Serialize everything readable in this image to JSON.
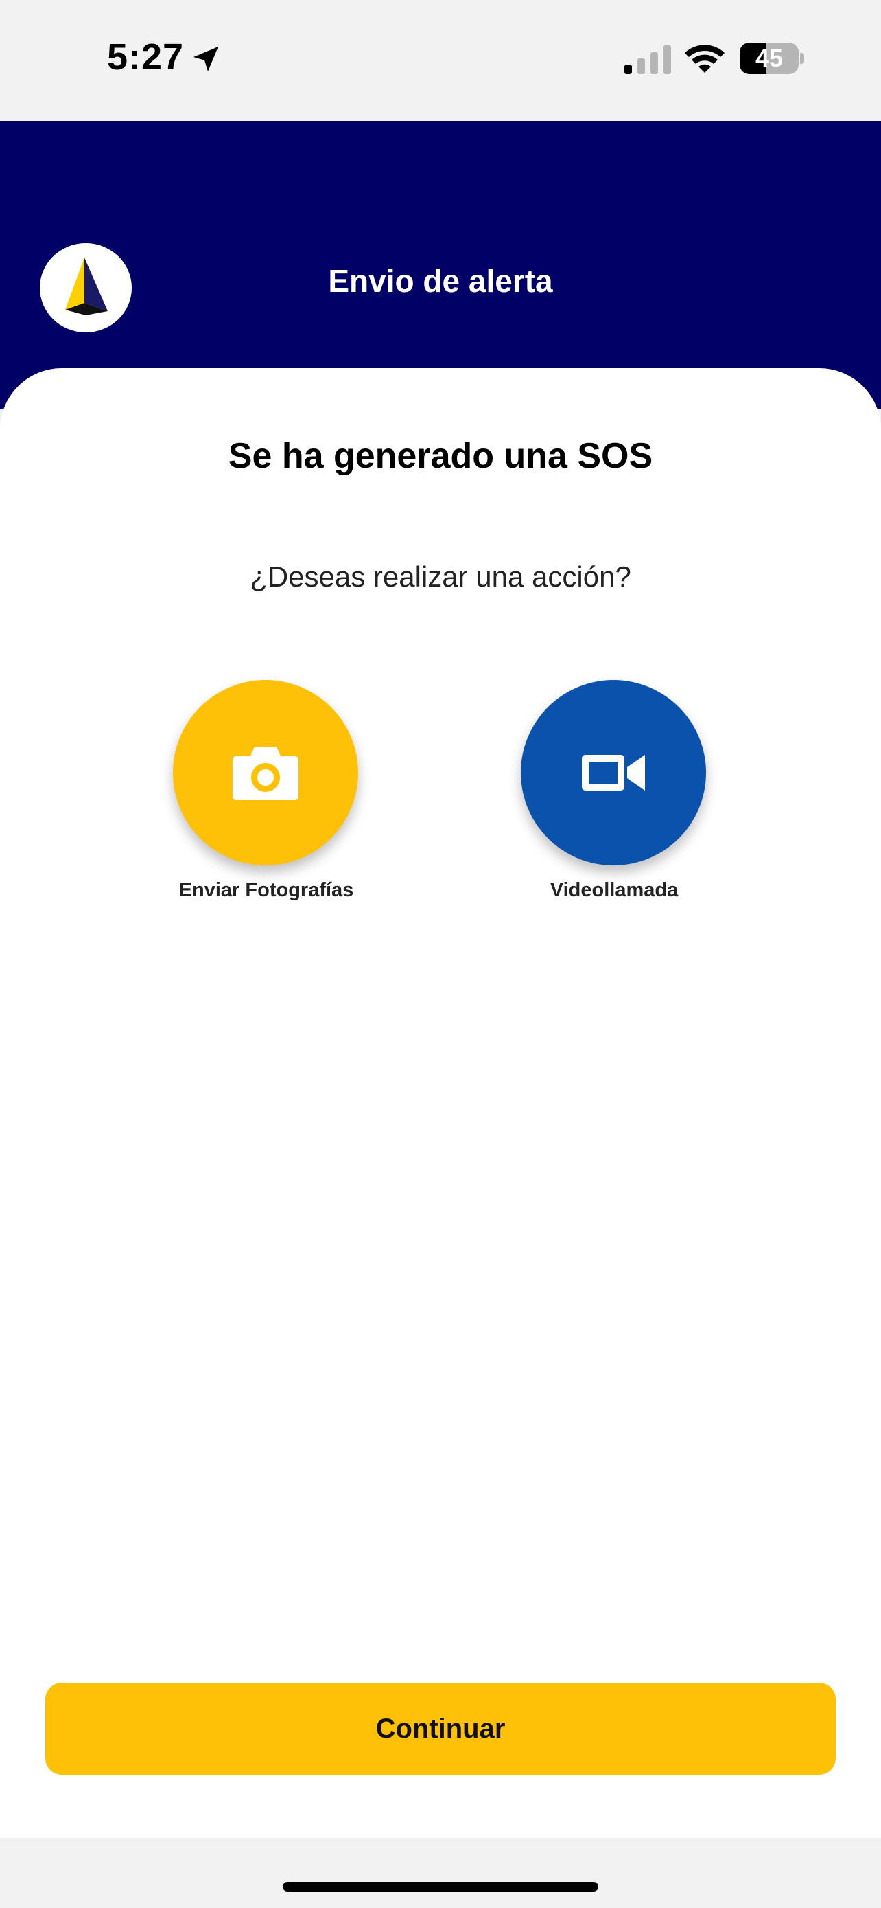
{
  "status_bar": {
    "time": "5:27",
    "battery_level": "45",
    "icons": [
      "location-arrow-icon",
      "cellular-signal-icon",
      "wifi-icon",
      "battery-icon"
    ]
  },
  "header": {
    "title": "Envio de alerta",
    "logo_icon": "triangle-logo-icon",
    "background_color": "#000066"
  },
  "content": {
    "title": "Se ha generado una SOS",
    "question": "¿Deseas realizar una acción?"
  },
  "actions": [
    {
      "label": "Enviar Fotografías",
      "icon": "camera-icon",
      "color": "#ffc107"
    },
    {
      "label": "Videollamada",
      "icon": "video-camera-icon",
      "color": "#0a52ac"
    }
  ],
  "footer": {
    "continue_label": "Continuar",
    "button_color": "#ffc107"
  }
}
